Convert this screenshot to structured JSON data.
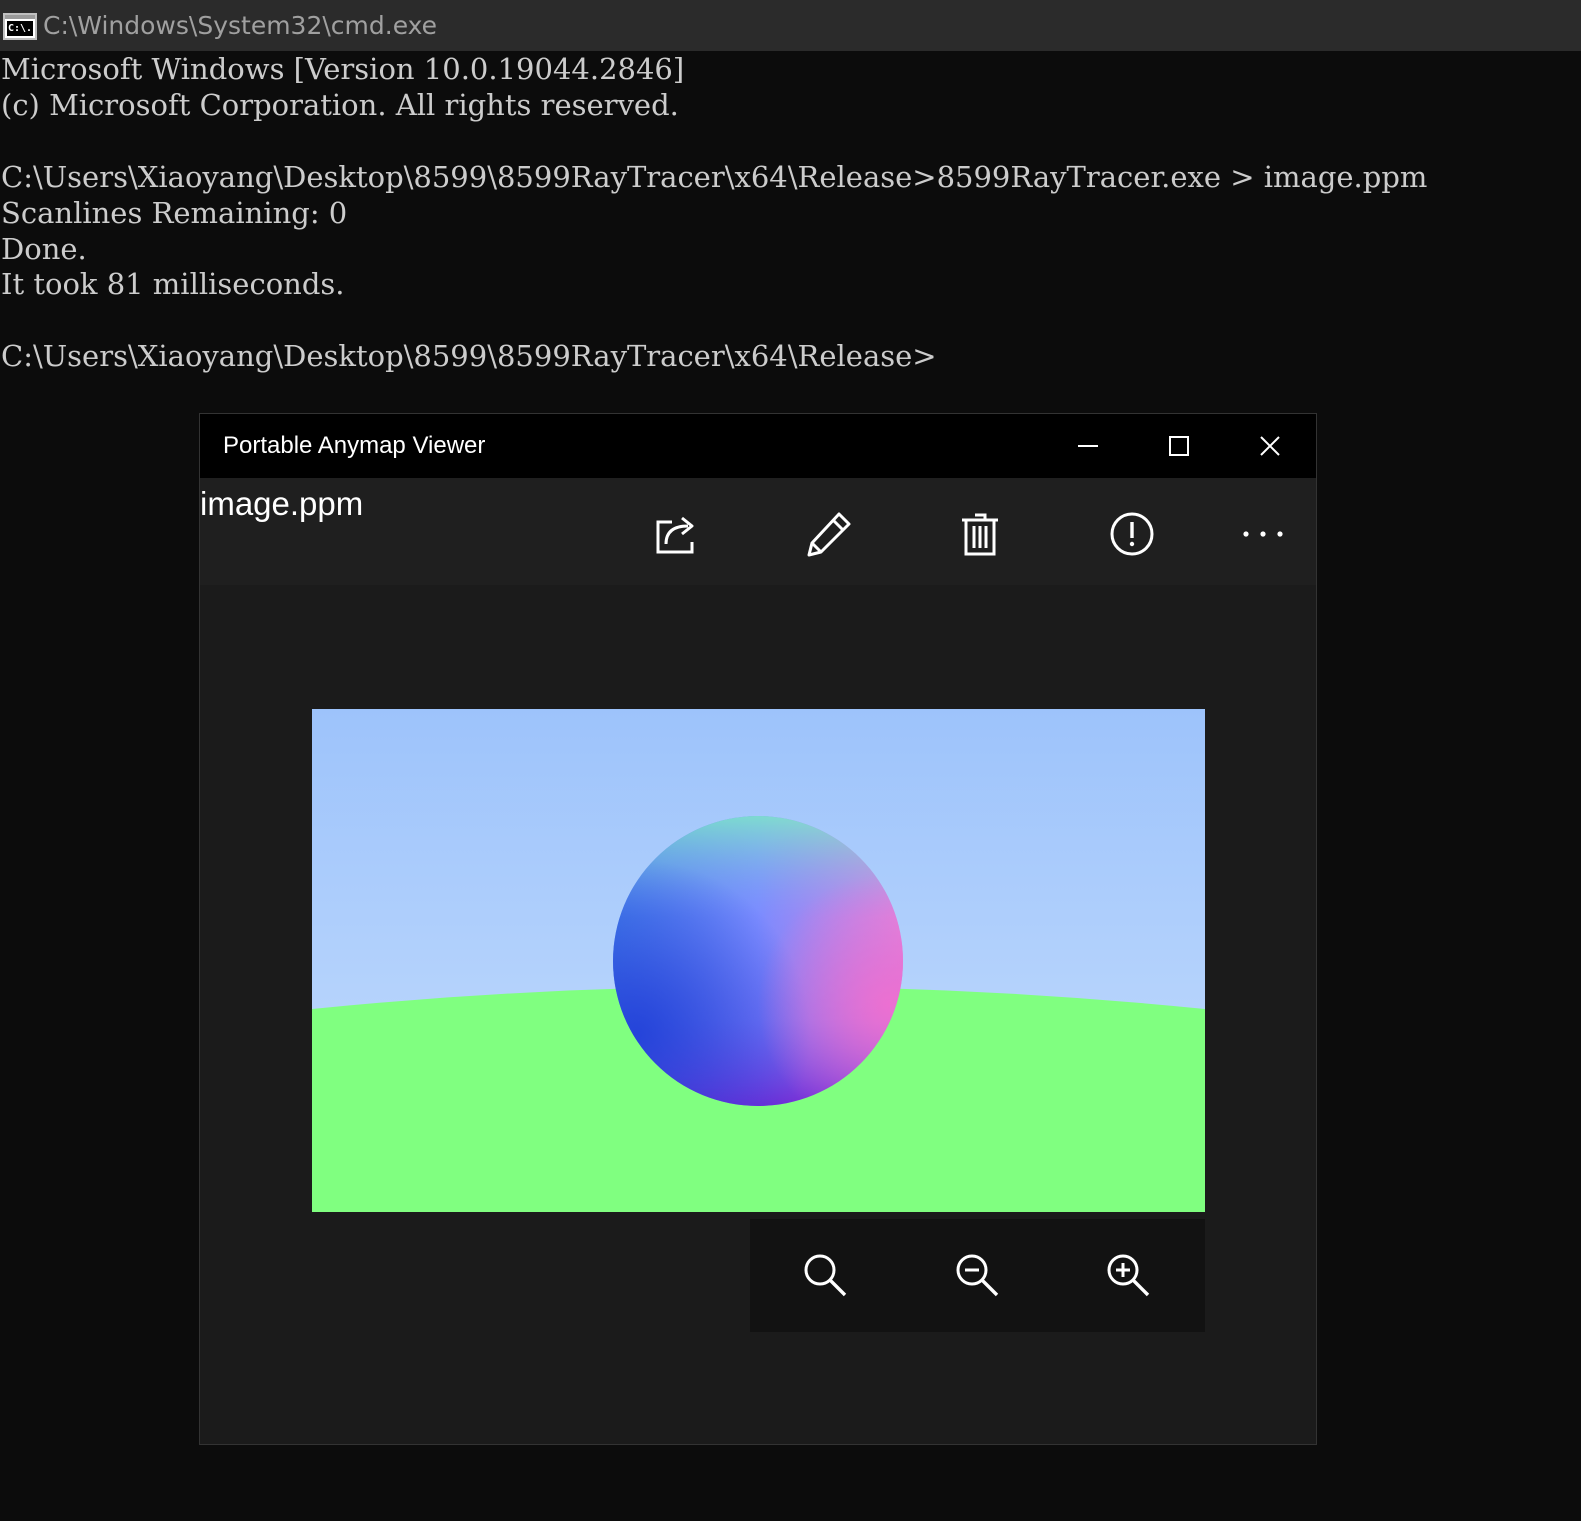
{
  "cmd": {
    "title": "C:\\Windows\\System32\\cmd.exe",
    "icon_text": "C:\\.",
    "icon": "console-app-icon",
    "lines": [
      "Microsoft Windows [Version 10.0.19044.2846]",
      "(c) Microsoft Corporation. All rights reserved.",
      "",
      "C:\\Users\\Xiaoyang\\Desktop\\8599\\8599RayTracer\\x64\\Release>8599RayTracer.exe > image.ppm",
      "Scanlines Remaining: 0",
      "Done.",
      "It took 81 milliseconds.",
      "",
      "C:\\Users\\Xiaoyang\\Desktop\\8599\\8599RayTracer\\x64\\Release>"
    ]
  },
  "viewer": {
    "title": "Portable Anymap Viewer",
    "window_controls": [
      "minimize-icon",
      "maximize-icon",
      "close-icon"
    ],
    "file_name": "image.ppm",
    "toolbar": [
      "share-icon",
      "edit-pencil-icon",
      "delete-trash-icon",
      "info-alert-icon",
      "more-ellipsis-icon"
    ],
    "zoom_controls": [
      "zoom-reset-icon",
      "zoom-out-icon",
      "zoom-in-icon"
    ],
    "image": {
      "description_colors": {
        "sky_top": "#9dc3fb",
        "sky_bottom": "#c3dcfd",
        "ground": "#80ff80"
      }
    }
  }
}
